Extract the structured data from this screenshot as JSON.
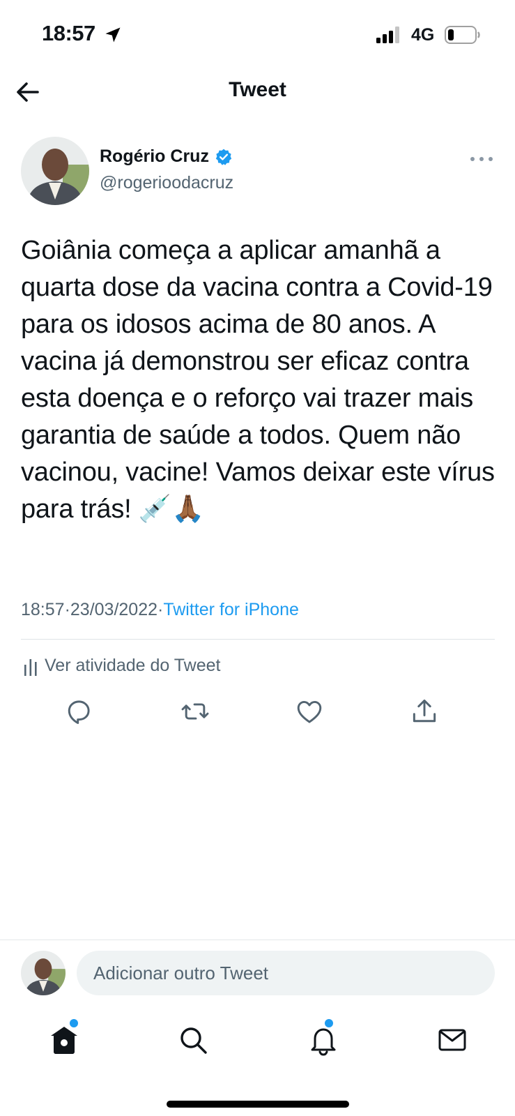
{
  "status_bar": {
    "time": "18:57",
    "network": "4G",
    "icons": [
      "location-arrow-icon",
      "signal-bars-icon",
      "battery-icon"
    ]
  },
  "header": {
    "title": "Tweet",
    "back_icon": "arrow-left-icon"
  },
  "author": {
    "name": "Rogério Cruz",
    "handle": "@rogerioodacruz",
    "verified": true,
    "more_icon": "ellipsis-icon"
  },
  "tweet": {
    "text": "Goiânia começa a aplicar amanhã a quarta dose da vacina contra a Covid-19 para os idosos acima de 80 anos. A vacina já demonstrou ser eficaz contra esta doença e o reforço vai trazer mais garantia de saúde a todos. Quem não vacinou, vacine! Vamos deixar este vírus para trás! 💉🙏🏾",
    "time": "18:57",
    "date": "23/03/2022",
    "separator": " · ",
    "source": "Twitter for iPhone"
  },
  "activity": {
    "label": "Ver atividade do Tweet",
    "icon": "bar-chart-icon"
  },
  "actions": [
    {
      "name": "reply",
      "icon": "speech-bubble-icon"
    },
    {
      "name": "retweet",
      "icon": "retweet-icon"
    },
    {
      "name": "like",
      "icon": "heart-icon"
    },
    {
      "name": "share",
      "icon": "share-upload-icon"
    }
  ],
  "composer": {
    "placeholder": "Adicionar outro Tweet"
  },
  "bottom_nav": [
    {
      "name": "home",
      "icon": "home-icon",
      "badge": true
    },
    {
      "name": "search",
      "icon": "search-icon",
      "badge": false
    },
    {
      "name": "notifications",
      "icon": "bell-icon",
      "badge": true
    },
    {
      "name": "messages",
      "icon": "mail-icon",
      "badge": false
    }
  ],
  "colors": {
    "accent": "#1d9bf0",
    "text_primary": "#0f1419",
    "text_secondary": "#536471",
    "input_bg": "#eff3f4"
  }
}
